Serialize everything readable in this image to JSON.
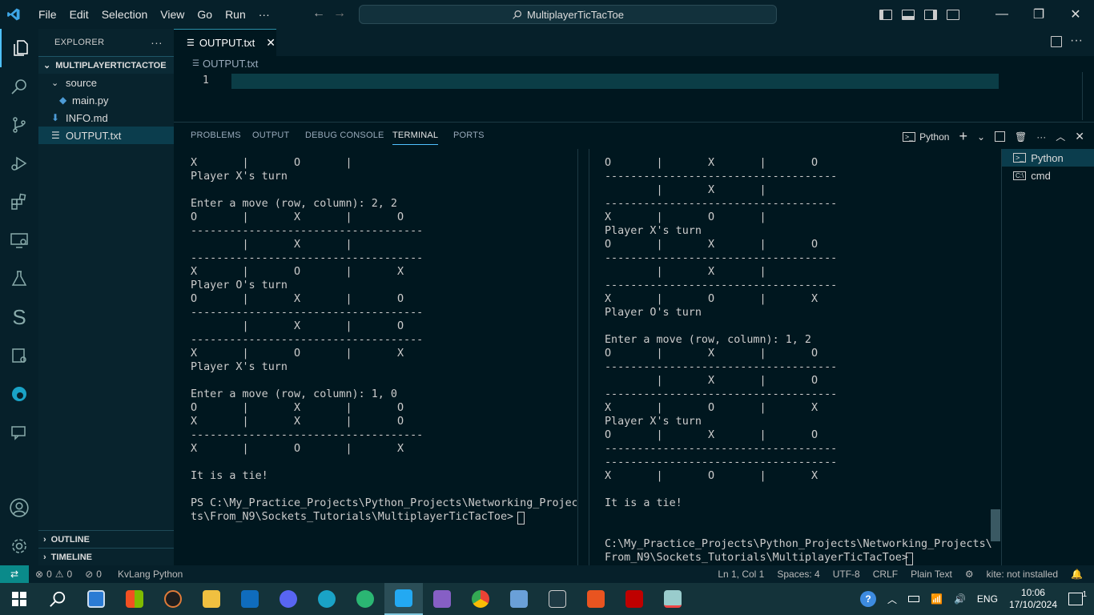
{
  "titlebar": {
    "menu": [
      "File",
      "Edit",
      "Selection",
      "View",
      "Go",
      "Run",
      "···"
    ],
    "search_text": "MultiplayerTicTacToe"
  },
  "sidebar": {
    "header": "EXPLORER",
    "more": "···",
    "root": "MULTIPLAYERTICTACTOE",
    "items": [
      {
        "label": "source",
        "kind": "folder"
      },
      {
        "label": "main.py",
        "kind": "python-file"
      },
      {
        "label": "INFO.md",
        "kind": "markdown-file"
      },
      {
        "label": "OUTPUT.txt",
        "kind": "text-file"
      }
    ],
    "outline": "OUTLINE",
    "timeline": "TIMELINE"
  },
  "editor": {
    "tab_label": "OUTPUT.txt",
    "breadcrumb": "OUTPUT.txt",
    "line_number": "1"
  },
  "panel": {
    "tabs": [
      "PROBLEMS",
      "OUTPUT",
      "DEBUG CONSOLE",
      "TERMINAL",
      "PORTS"
    ],
    "active_tab": "TERMINAL",
    "profile": "Python",
    "terminals": [
      "Python",
      "cmd"
    ],
    "term_left": "X       |       O       |\nPlayer X's turn\n\nEnter a move (row, column): 2, 2\nO       |       X       |       O\n------------------------------------\n        |       X       |\n------------------------------------\nX       |       O       |       X\nPlayer O's turn\nO       |       X       |       O\n------------------------------------\n        |       X       |       O\n------------------------------------\nX       |       O       |       X\nPlayer X's turn\n\nEnter a move (row, column): 1, 0\nO       |       X       |       O\nX       |       X       |       O\n------------------------------------\nX       |       O       |       X\n\nIt is a tie!\n\nPS C:\\My_Practice_Projects\\Python_Projects\\Networking_Projec\nts\\From_N9\\Sockets_Tutorials\\MultiplayerTicTacToe> ",
    "term_right": "O       |       X       |       O\n------------------------------------\n        |       X       |\n------------------------------------\nX       |       O       |\nPlayer X's turn\nO       |       X       |       O\n------------------------------------\n        |       X       |\n------------------------------------\nX       |       O       |       X\nPlayer O's turn\n\nEnter a move (row, column): 1, 2\nO       |       X       |       O\n------------------------------------\n        |       X       |       O\n------------------------------------\nX       |       O       |       X\nPlayer X's turn\nO       |       X       |       O\n------------------------------------\n------------------------------------\nX       |       O       |       X\n\nIt is a tie!\n\n\nC:\\My_Practice_Projects\\Python_Projects\\Networking_Projects\\\nFrom_N9\\Sockets_Tutorials\\MultiplayerTicTacToe>"
  },
  "statusbar": {
    "errors": "0",
    "warnings": "0",
    "ports": "0",
    "kvlang": "KvLang Python",
    "position": "Ln 1, Col 1",
    "spaces": "Spaces: 4",
    "encoding": "UTF-8",
    "eol": "CRLF",
    "language": "Plain Text",
    "kite": "kite: not installed"
  },
  "taskbar": {
    "lang": "ENG",
    "time": "10:06",
    "date": "17/10/2024",
    "notifications": "1"
  },
  "colors": {
    "accent": "#4fc1ff",
    "background": "#00171f",
    "remote": "#0a8a8a"
  }
}
